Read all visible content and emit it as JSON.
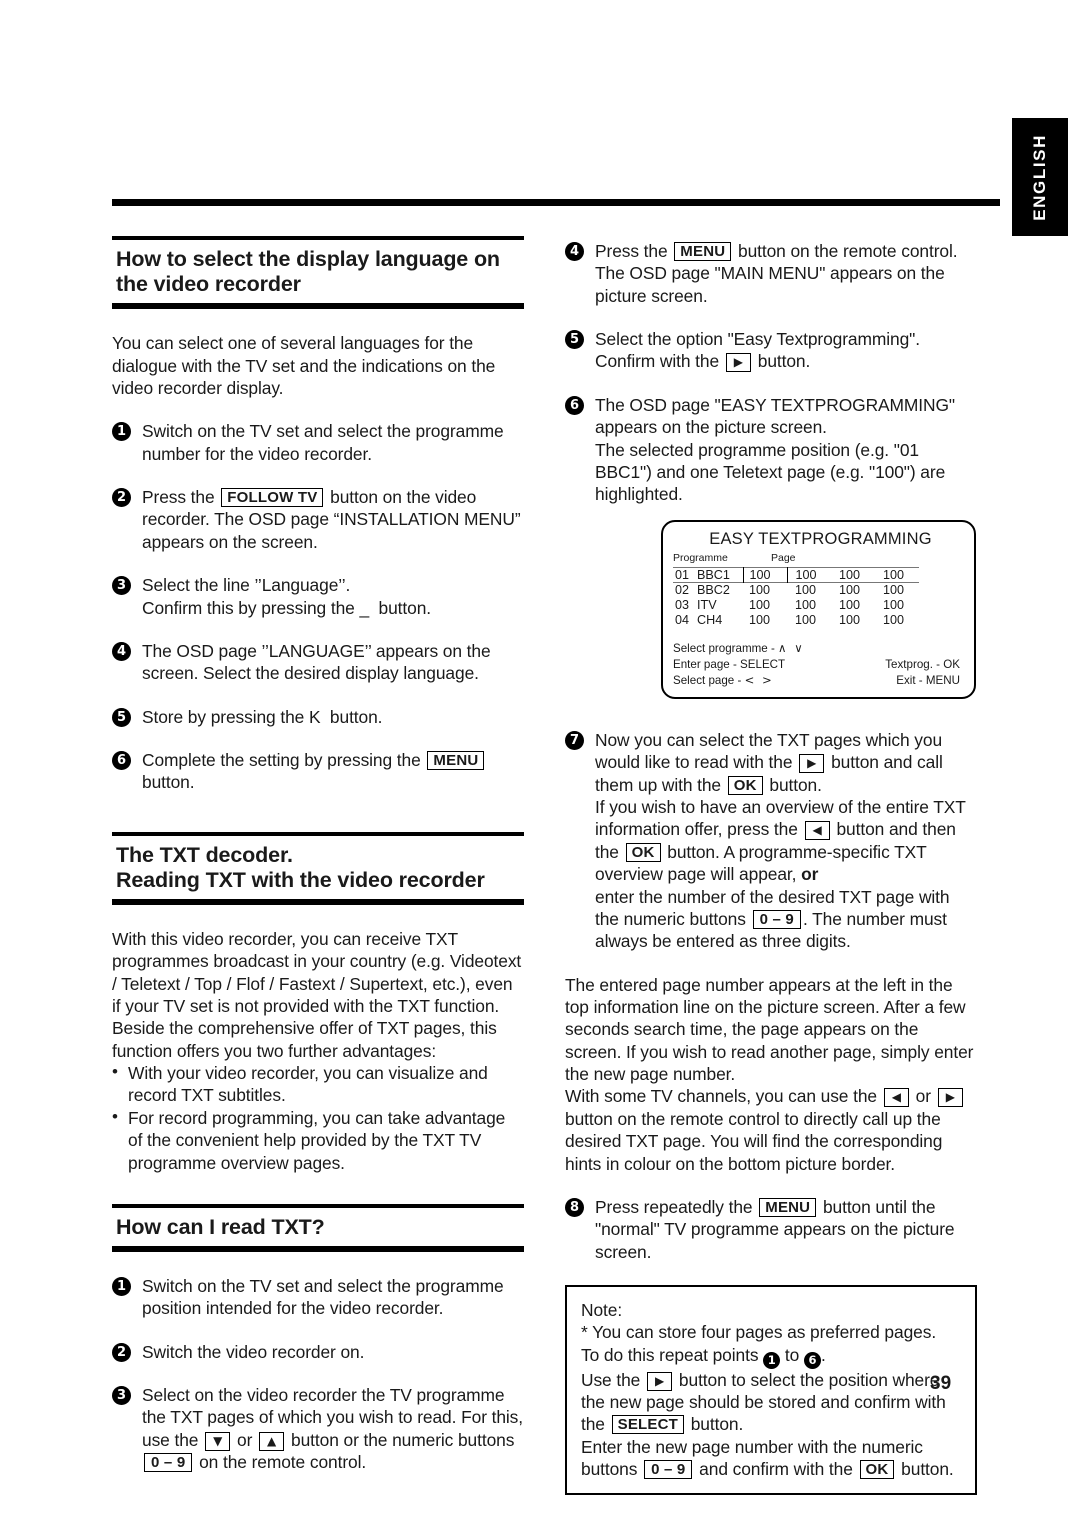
{
  "page": {
    "number": "39",
    "language_tab": "ENGLISH"
  },
  "left_column": {
    "section1": {
      "title": "How to select the display language on the video recorder",
      "intro": "You can select one of several languages for the dialogue with the TV set and the indications on the video recorder display.",
      "steps": [
        {
          "num": "1",
          "text_a": "Switch on the TV set and select the programme number for the video recorder.",
          "key": "",
          "text_b": ""
        },
        {
          "num": "2",
          "text_a": "Press the ",
          "key": "FOLLOW TV",
          "text_b": " button on the video recorder. The OSD page “INSTALLATION  MENU” appears on the screen."
        },
        {
          "num": "3",
          "text_a": "Select the line ’’Language’’.\nConfirm this by pressing the ",
          "key": "_",
          "text_b": "  button."
        },
        {
          "num": "4",
          "text_a": "The OSD page ’’LANGUAGE’’ appears on the screen. Select the desired display language.",
          "key": "",
          "text_b": ""
        },
        {
          "num": "5",
          "text_a": "Store by pressing the ",
          "key": "K",
          "text_b": "  button."
        },
        {
          "num": "6",
          "text_a": "Complete the setting by pressing the ",
          "key": "MENU",
          "text_b": " button."
        }
      ]
    },
    "section2": {
      "title_line1": "The TXT decoder.",
      "title_line2": "Reading TXT with the video recorder",
      "paragraph": "With this video recorder, you can receive TXT programmes broadcast in your country (e.g. Videotext / Teletext / Top / Flof / Fastext / Supertext, etc.), even if your TV set is not provided with the TXT function.\nBeside the comprehensive offer of TXT pages, this function offers you two further advantages:",
      "bullets": [
        "With your video recorder, you can visualize and record TXT subtitles.",
        "For record programming, you can take advantage of the convenient help provided by the TXT TV programme overview pages."
      ]
    },
    "section3": {
      "title": "How can I read TXT?",
      "steps": [
        {
          "num": "1",
          "text": "Switch on the TV set and select the programme position intended for the video recorder."
        },
        {
          "num": "2",
          "text": "Switch the video recorder on."
        },
        {
          "num": "3",
          "text_a": "Select on the video recorder the TV programme the TXT pages of which you wish to read. For this, use the ",
          "key1": "▼",
          "text_b": " or ",
          "key2": "▲",
          "text_c": " button or the numeric buttons ",
          "key3": "0 – 9",
          "text_d": " on the remote control."
        }
      ]
    }
  },
  "right_column": {
    "steps": [
      {
        "num": "4",
        "text_a": "Press the ",
        "key": "MENU",
        "text_b": " button on the remote control. The OSD page \"MAIN MENU\" appears on the picture screen."
      },
      {
        "num": "5",
        "text_a": "Select the option \"Easy Textprogramming\".\nConfirm with the ",
        "key": "▶",
        "text_b": " button."
      },
      {
        "num": "6",
        "text_a": "The OSD page \"EASY TEXTPROGRAMMING\" appears on the picture screen.\nThe selected programme position (e.g. \"01  BBC1\") and one Teletext page (e.g. \"100\") are highlighted.",
        "key": "",
        "text_b": ""
      }
    ],
    "osd": {
      "title": "EASY TEXTPROGRAMMING",
      "head_programme": "Programme",
      "head_page": "Page",
      "rows": [
        {
          "pos": "01",
          "name": "BBC1",
          "pages": [
            "100",
            "100",
            "100",
            "100"
          ],
          "highlighted": true
        },
        {
          "pos": "02",
          "name": "BBC2",
          "pages": [
            "100",
            "100",
            "100",
            "100"
          ],
          "highlighted": false
        },
        {
          "pos": "03",
          "name": "ITV",
          "pages": [
            "100",
            "100",
            "100",
            "100"
          ],
          "highlighted": false
        },
        {
          "pos": "04",
          "name": "CH4",
          "pages": [
            "100",
            "100",
            "100",
            "100"
          ],
          "highlighted": false
        }
      ],
      "footer": {
        "line1_left": "Select programme -",
        "line1_arrows": "∧ ∨",
        "line2_left": "Enter page - SELECT",
        "line2_right": "Textprog. - OK",
        "line3_left": "Select page -",
        "line3_arrows": "< >",
        "line3_right": "Exit - MENU"
      }
    },
    "step7": {
      "num": "7",
      "t1": "Now you can select the TXT pages which you would like to read with the ",
      "k1": "▶",
      "t2": " button and call them up with the ",
      "k2": "OK",
      "t3": " button.\nIf you wish to have an overview of the entire TXT information offer, press the ",
      "k3": "◀",
      "t4": " button and then the ",
      "k4": "OK",
      "t5": " button. A programme-specific TXT overview page will appear, ",
      "bold": "or",
      "t6": "\nenter the number of the desired TXT page with the numeric buttons ",
      "k5": "0 – 9",
      "t7": ". The number must always be entered as three digits."
    },
    "paragraph": {
      "p1": "The entered page number appears at the left in the top information line on the picture screen. After a few seconds search time, the page appears on the screen. If you wish to read another page, simply enter the new page number.\nWith some TV channels, you can use the ",
      "k1": "◀",
      "p2": " or ",
      "k2": "▶",
      "p3": " button on the remote control to directly call up the desired TXT page. You will find the corresponding hints in colour on the bottom picture border."
    },
    "step8": {
      "num": "8",
      "t1": "Press repeatedly the ",
      "k1": "MENU",
      "t2": " button until the \"normal\" TV programme appears on the picture screen."
    },
    "note": {
      "label": "Note:",
      "l1": "* You can store four pages as preferred pages.",
      "l2a": "To do this repeat points ",
      "n1": "1",
      "l2b": " to ",
      "n2": "6",
      "l2c": ".",
      "l3a": "Use the ",
      "k1": "▶",
      "l3b": " button to select the position where the new page should be stored and confirm with the ",
      "k2": "SELECT",
      "l3c": " button.",
      "l4a": "Enter the new page number with the numeric buttons ",
      "k3": "0 – 9",
      "l4b": " and confirm with the ",
      "k4": "OK",
      "l4c": " button."
    }
  }
}
